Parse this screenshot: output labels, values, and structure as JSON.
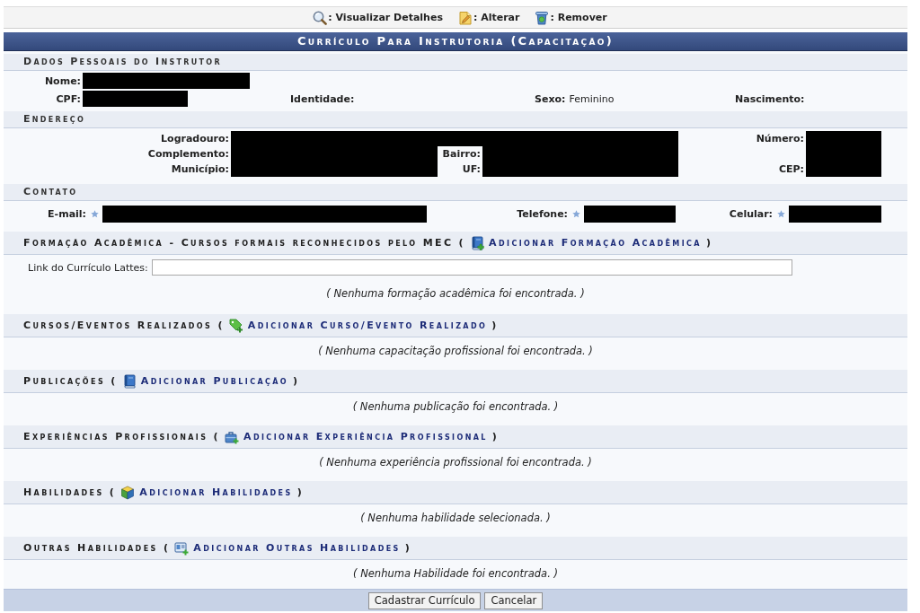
{
  "legend": [
    {
      "kind": "view",
      "label": ": Visualizar Detalhes"
    },
    {
      "kind": "edit",
      "label": ": Alterar"
    },
    {
      "kind": "remove",
      "label": ": Remover"
    }
  ],
  "title": "Currículo Para Instrutoria (Capacitação)",
  "personal": {
    "heading": "Dados Pessoais do Instrutor",
    "rows": [
      [
        {
          "label": "Nome:",
          "redacted": true
        }
      ],
      [
        {
          "label": "CPF:",
          "redacted": true
        },
        {
          "label": "Identidade:",
          "redacted": false
        },
        {
          "label": "Sexo:",
          "redacted": false,
          "value": "Feminino"
        },
        {
          "label": "Nascimento:",
          "redacted": false
        }
      ]
    ]
  },
  "address": {
    "heading": "Endereço",
    "rows": [
      [
        {
          "label": "Logradouro:",
          "redacted": true,
          "colspan": 2
        },
        {
          "label": "Número:",
          "redacted": true
        }
      ],
      [
        {
          "label": "Complemento:",
          "redacted": true
        },
        {
          "label": "Bairro:",
          "redacted": true
        },
        {
          "redacted": true
        }
      ],
      [
        {
          "label": "Município:",
          "redacted": true
        },
        {
          "label": "UF:",
          "redacted": true
        },
        {
          "label": "CEP:",
          "redacted": true
        }
      ]
    ]
  },
  "contact": {
    "heading": "Contato",
    "fields": [
      {
        "label": "E-mail:",
        "required": true,
        "redacted": true
      },
      {
        "label": "Telefone:",
        "required": true,
        "redacted": true
      },
      {
        "label": "Celular:",
        "required": true,
        "redacted": true
      }
    ]
  },
  "sections": [
    {
      "kind": "academic",
      "title": "Formação Acadêmica - Cursos formais reconhecidos pelo MEC (",
      "link": "Adicionar Formação Acadêmica",
      "title_end": ")",
      "field": {
        "label": "Link do Currículo Lattes:"
      },
      "message": "( Nenhuma formação acadêmica foi encontrada. )"
    },
    {
      "kind": "course",
      "title": "Cursos/Eventos Realizados (",
      "link": "Adicionar Curso/Evento Realizado",
      "title_end": ")",
      "message": "( Nenhuma capacitação profissional foi encontrada. )"
    },
    {
      "kind": "publication",
      "title": "Publicações (",
      "link": "Adicionar Publicação",
      "title_end": ")",
      "message": "( Nenhuma publicação foi encontrada. )"
    },
    {
      "kind": "experience",
      "title": "Experiências Profissionais (",
      "link": "Adicionar Experiência Profissional",
      "title_end": ")",
      "message": "( Nenhuma experiência profissional foi encontrada. )"
    },
    {
      "kind": "skills",
      "title": "Habilidades (",
      "link": "Adicionar Habilidades",
      "title_end": ")",
      "message": "( Nenhuma habilidade selecionada. )"
    },
    {
      "kind": "other_skills",
      "title": "Outras Habilidades (",
      "link": "Adicionar Outras Habilidades",
      "title_end": ")",
      "message": "( Nenhuma Habilidade foi encontrada. )"
    }
  ],
  "buttons": [
    "Cadastrar Currículo",
    "Cancelar"
  ]
}
